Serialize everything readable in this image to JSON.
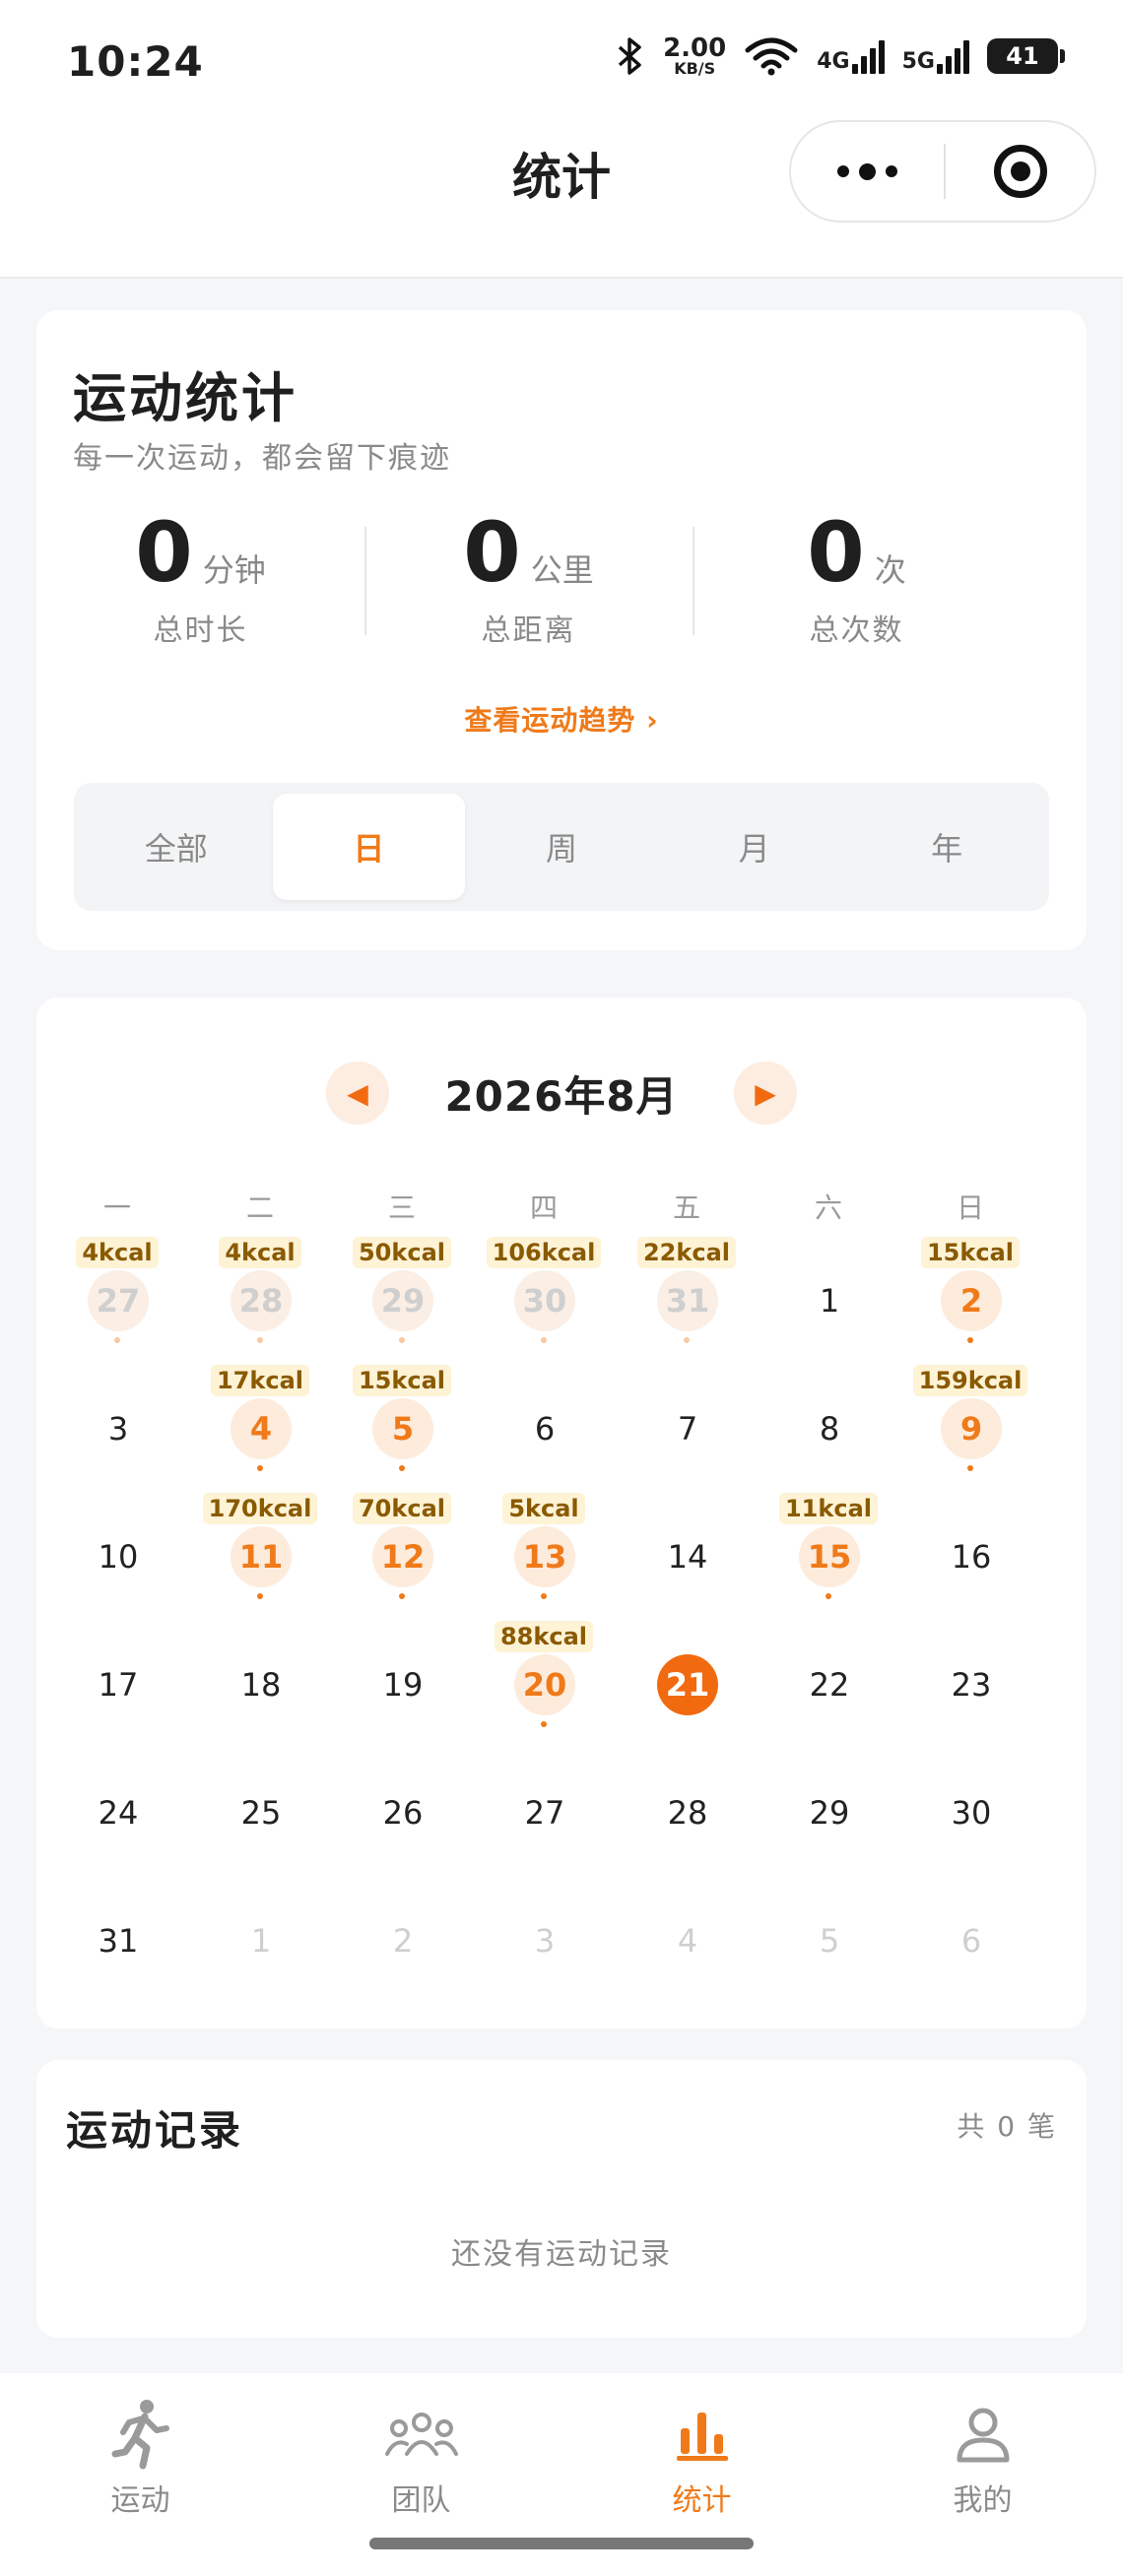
{
  "status": {
    "time": "10:24",
    "speed_value": "2.00",
    "speed_unit": "KB/S",
    "net1": "4G",
    "net2": "5G",
    "battery": "41"
  },
  "nav": {
    "title": "统计",
    "more_icon": "more-dots-icon",
    "target_icon": "target-icon"
  },
  "stats": {
    "title": "运动统计",
    "subtitle": "每一次运动，都会留下痕迹",
    "metrics": [
      {
        "value": "0",
        "unit": "分钟",
        "label": "总时长"
      },
      {
        "value": "0",
        "unit": "公里",
        "label": "总距离"
      },
      {
        "value": "0",
        "unit": "次",
        "label": "总次数"
      }
    ],
    "trend_link": "查看运动趋势 ›",
    "segments": [
      "全部",
      "日",
      "周",
      "月",
      "年"
    ],
    "active_segment": 1
  },
  "calendar": {
    "prev": "◀",
    "next": "▶",
    "month": "2026年8月",
    "weekdays": [
      "一",
      "二",
      "三",
      "四",
      "五",
      "六",
      "日"
    ],
    "days": [
      {
        "d": "27",
        "kcal": "4kcal",
        "state": "past",
        "dot": true
      },
      {
        "d": "28",
        "kcal": "4kcal",
        "state": "past",
        "dot": true
      },
      {
        "d": "29",
        "kcal": "50kcal",
        "state": "past",
        "dot": true
      },
      {
        "d": "30",
        "kcal": "106kcal",
        "state": "past",
        "dot": true
      },
      {
        "d": "31",
        "kcal": "22kcal",
        "state": "past",
        "dot": true
      },
      {
        "d": "1",
        "kcal": "",
        "state": "normal",
        "dot": false
      },
      {
        "d": "2",
        "kcal": "15kcal",
        "state": "record",
        "dot": true
      },
      {
        "d": "3",
        "kcal": "",
        "state": "normal",
        "dot": false
      },
      {
        "d": "4",
        "kcal": "17kcal",
        "state": "record",
        "dot": true
      },
      {
        "d": "5",
        "kcal": "15kcal",
        "state": "record",
        "dot": true
      },
      {
        "d": "6",
        "kcal": "",
        "state": "normal",
        "dot": false
      },
      {
        "d": "7",
        "kcal": "",
        "state": "normal",
        "dot": false
      },
      {
        "d": "8",
        "kcal": "",
        "state": "normal",
        "dot": false
      },
      {
        "d": "9",
        "kcal": "159kcal",
        "state": "record",
        "dot": true
      },
      {
        "d": "10",
        "kcal": "",
        "state": "normal",
        "dot": false
      },
      {
        "d": "11",
        "kcal": "170kcal",
        "state": "record",
        "dot": true
      },
      {
        "d": "12",
        "kcal": "70kcal",
        "state": "record",
        "dot": true
      },
      {
        "d": "13",
        "kcal": "5kcal",
        "state": "record",
        "dot": true
      },
      {
        "d": "14",
        "kcal": "",
        "state": "normal",
        "dot": false
      },
      {
        "d": "15",
        "kcal": "11kcal",
        "state": "record",
        "dot": true
      },
      {
        "d": "16",
        "kcal": "",
        "state": "normal",
        "dot": false
      },
      {
        "d": "17",
        "kcal": "",
        "state": "normal",
        "dot": false
      },
      {
        "d": "18",
        "kcal": "",
        "state": "normal",
        "dot": false
      },
      {
        "d": "19",
        "kcal": "",
        "state": "normal",
        "dot": false
      },
      {
        "d": "20",
        "kcal": "88kcal",
        "state": "record",
        "dot": true
      },
      {
        "d": "21",
        "kcal": "",
        "state": "today",
        "dot": false
      },
      {
        "d": "22",
        "kcal": "",
        "state": "normal",
        "dot": false
      },
      {
        "d": "23",
        "kcal": "",
        "state": "normal",
        "dot": false
      },
      {
        "d": "24",
        "kcal": "",
        "state": "normal",
        "dot": false
      },
      {
        "d": "25",
        "kcal": "",
        "state": "normal",
        "dot": false
      },
      {
        "d": "26",
        "kcal": "",
        "state": "normal",
        "dot": false
      },
      {
        "d": "27",
        "kcal": "",
        "state": "normal",
        "dot": false
      },
      {
        "d": "28",
        "kcal": "",
        "state": "normal",
        "dot": false
      },
      {
        "d": "29",
        "kcal": "",
        "state": "normal",
        "dot": false
      },
      {
        "d": "30",
        "kcal": "",
        "state": "normal",
        "dot": false
      },
      {
        "d": "31",
        "kcal": "",
        "state": "normal",
        "dot": false
      },
      {
        "d": "1",
        "kcal": "",
        "state": "next",
        "dot": false
      },
      {
        "d": "2",
        "kcal": "",
        "state": "next",
        "dot": false
      },
      {
        "d": "3",
        "kcal": "",
        "state": "next",
        "dot": false
      },
      {
        "d": "4",
        "kcal": "",
        "state": "next",
        "dot": false
      },
      {
        "d": "5",
        "kcal": "",
        "state": "next",
        "dot": false
      },
      {
        "d": "6",
        "kcal": "",
        "state": "next",
        "dot": false
      }
    ]
  },
  "records": {
    "title": "运动记录",
    "count": "共 0 笔",
    "empty": "还没有运动记录"
  },
  "tabs": [
    {
      "label": "运动",
      "icon": "runner-icon"
    },
    {
      "label": "团队",
      "icon": "team-icon"
    },
    {
      "label": "统计",
      "icon": "bar-chart-icon",
      "active": true
    },
    {
      "label": "我的",
      "icon": "user-icon"
    }
  ],
  "colors": {
    "accent": "#f07a19",
    "today": "#f26a10",
    "kcal_bg": "#fff3d6",
    "background": "#f5f6f8"
  }
}
